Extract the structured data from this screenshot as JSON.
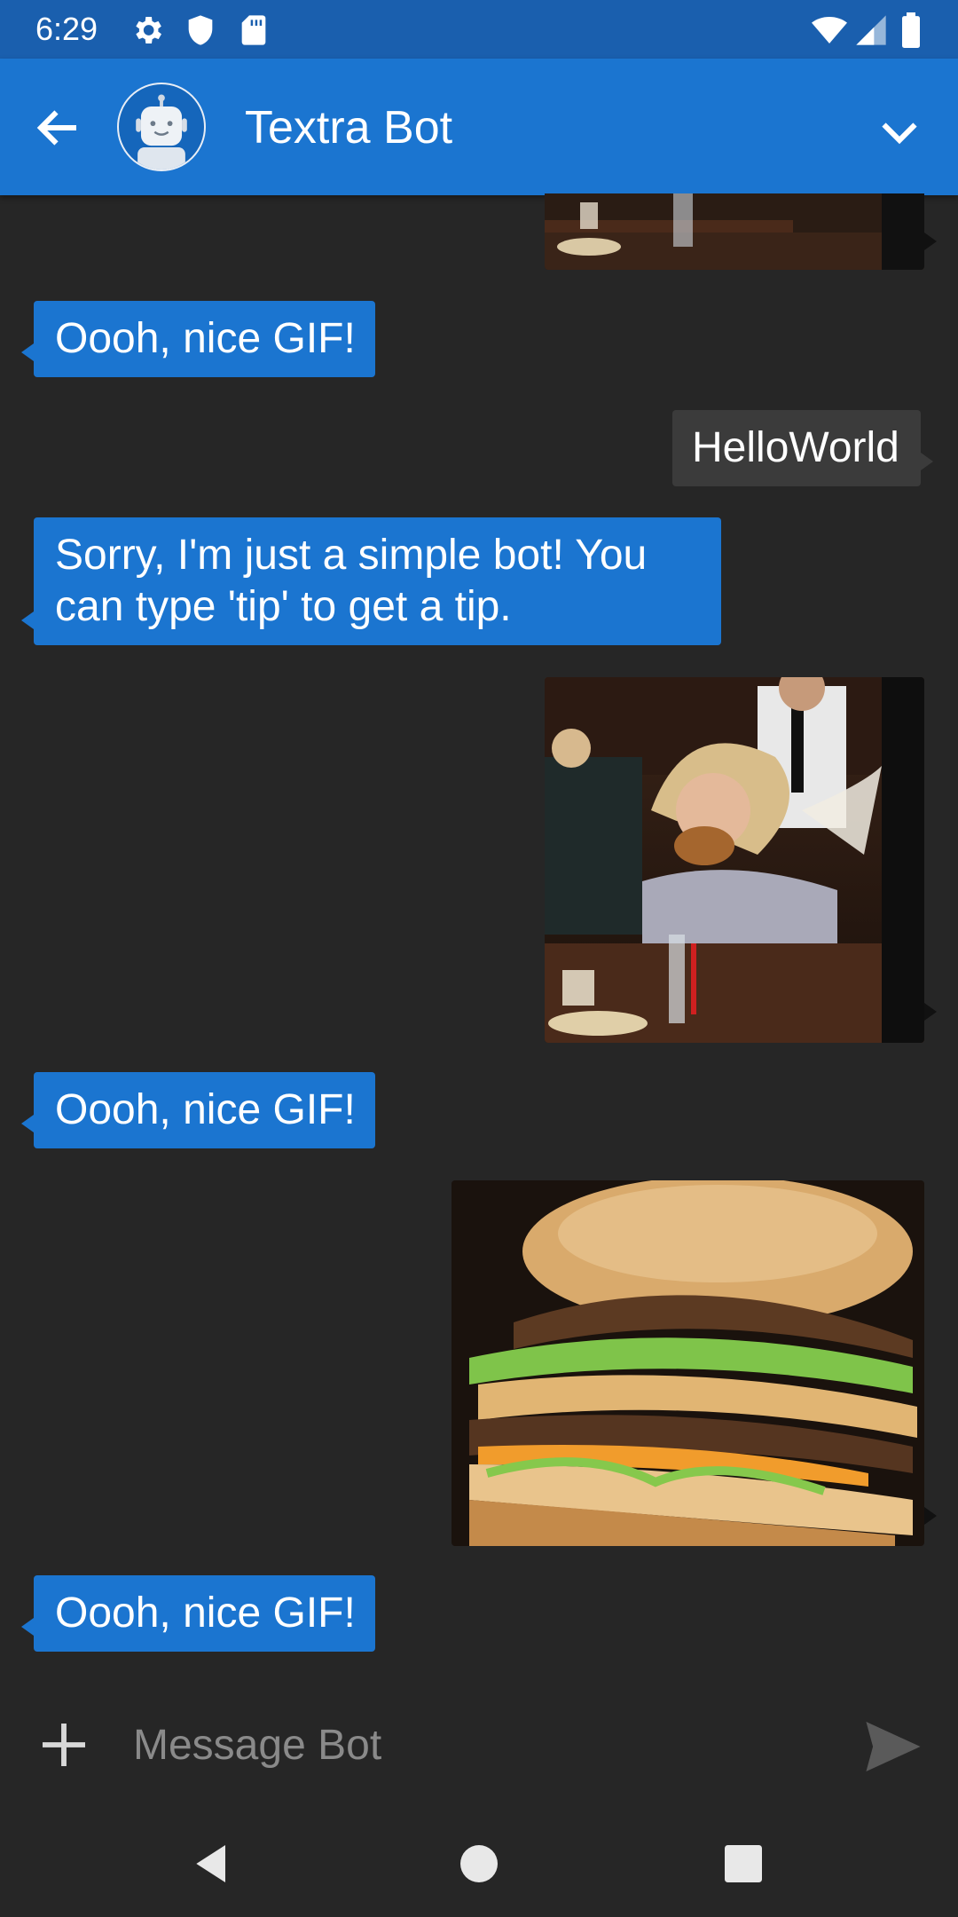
{
  "status_bar": {
    "time": "6:29",
    "icons": [
      "settings-icon",
      "shield-icon",
      "sd-card-icon",
      "wifi-icon",
      "signal-icon",
      "battery-icon"
    ]
  },
  "header": {
    "title": "Textra Bot",
    "avatar": "robot-avatar",
    "back_icon": "back-arrow-icon",
    "menu_icon": "chevron-down-icon",
    "color": "#1b75d0"
  },
  "messages": [
    {
      "from": "me",
      "type": "gif",
      "desc_icon": "woman-eating-burger-gif"
    },
    {
      "from": "bot",
      "text": "Oooh, nice GIF!"
    },
    {
      "from": "me",
      "text": "HelloWorld"
    },
    {
      "from": "bot",
      "text": "Sorry, I'm just a simple bot! You can type 'tip' to get a tip."
    },
    {
      "from": "me",
      "type": "gif",
      "desc_icon": "woman-eating-burger-gif"
    },
    {
      "from": "bot",
      "text": "Oooh, nice GIF!"
    },
    {
      "from": "me",
      "type": "gif",
      "desc_icon": "burger-gif"
    },
    {
      "from": "bot",
      "text": "Oooh, nice GIF!"
    }
  ],
  "composer": {
    "placeholder": "Message Bot",
    "attach_icon": "plus-icon",
    "send_icon": "send-icon"
  },
  "nav_bar": {
    "icons": [
      "back-triangle-icon",
      "home-circle-icon",
      "recents-square-icon"
    ]
  },
  "colors": {
    "bot_bubble": "#1b75d0",
    "my_bubble": "#3b3b3b",
    "background": "#262626"
  }
}
